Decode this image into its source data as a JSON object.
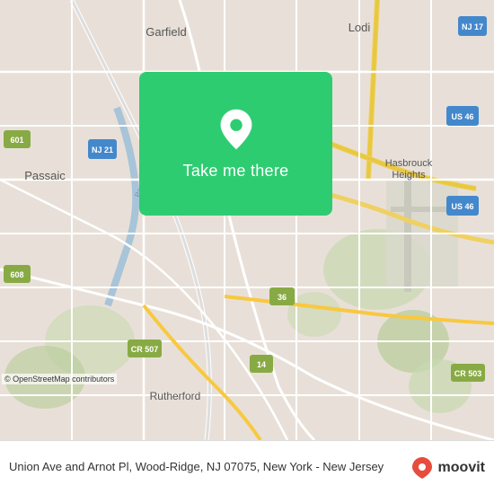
{
  "map": {
    "background_color": "#e8e0d8",
    "overlay_color": "#2ecc71"
  },
  "button": {
    "label": "Take me there"
  },
  "bottom_bar": {
    "address": "Union Ave and Arnot Pl, Wood-Ridge, NJ 07075, New\nYork - New Jersey",
    "brand": "moovit"
  },
  "attribution": {
    "text": "© OpenStreetMap contributors"
  },
  "places": {
    "garfield": "Garfield",
    "lodi": "Lodi",
    "passaic": "Passaic",
    "rutherford": "Rutherford",
    "hasbrouck_heights": "Hasbrouck\nHeights"
  },
  "route_shields": {
    "nj17": "NJ 17",
    "nj21": "NJ 21",
    "us46a": "US 46",
    "us46b": "US 46",
    "r601": "601",
    "r608": "608",
    "r36": "36",
    "r507": "CR 507",
    "r14": "14",
    "r503": "CR 503"
  }
}
